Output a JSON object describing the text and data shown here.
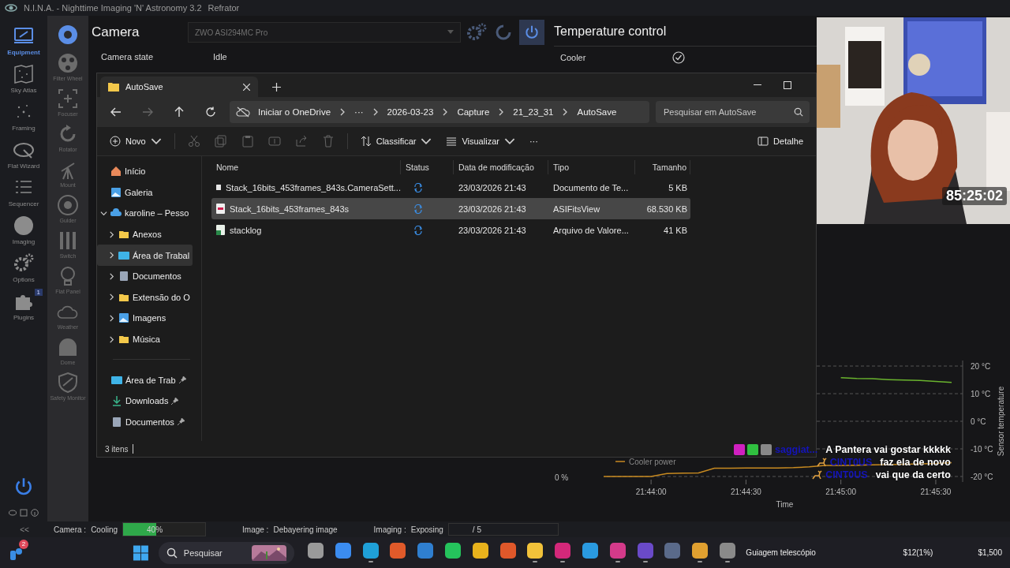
{
  "window": {
    "title": "N.I.N.A. - Nighttime Imaging 'N' Astronomy 3.2",
    "profile": "Refrator"
  },
  "main_nav": [
    {
      "label": "Equipment",
      "kind": "equipment",
      "selected": true
    },
    {
      "label": "Sky Atlas",
      "kind": "atlas",
      "selected": false
    },
    {
      "label": "Framing",
      "kind": "framing",
      "selected": false
    },
    {
      "label": "Flat Wizard",
      "kind": "flat",
      "selected": false
    },
    {
      "label": "Sequencer",
      "kind": "sequencer",
      "selected": false
    },
    {
      "label": "Imaging",
      "kind": "imaging",
      "selected": false
    },
    {
      "label": "Options",
      "kind": "options",
      "selected": false
    },
    {
      "label": "Plugins",
      "kind": "plugins",
      "selected": false,
      "badge": "1"
    }
  ],
  "equipment_nav": [
    {
      "kind": "camera",
      "selected": true
    },
    {
      "label": "Filter Wheel",
      "kind": "wheel",
      "selected": false
    },
    {
      "label": "Focuser",
      "kind": "focuser",
      "selected": false
    },
    {
      "label": "Rotator",
      "kind": "rotator",
      "selected": false
    },
    {
      "label": "Mount",
      "kind": "mount",
      "selected": false
    },
    {
      "label": "Guider",
      "kind": "guider",
      "selected": false
    },
    {
      "label": "Switch",
      "kind": "switch",
      "selected": false
    },
    {
      "label": "Flat Panel",
      "kind": "bulb",
      "selected": false
    },
    {
      "label": "Weather",
      "kind": "cloud",
      "selected": false
    },
    {
      "label": "Dome",
      "kind": "dome",
      "selected": false
    },
    {
      "label": "Safety Monitor",
      "kind": "shield",
      "selected": false
    }
  ],
  "camera": {
    "title": "Camera",
    "device": "ZWO ASI294MC Pro",
    "state_label": "Camera state",
    "state": "Idle"
  },
  "temperature": {
    "title": "Temperature control",
    "cooler_label": "Cooler",
    "cooler_on": true,
    "power_tick": "0 %",
    "chart_data": {
      "type": "line",
      "xlabel": "Time",
      "ylabel": "Sensor temperature",
      "categories": [
        null,
        null,
        null,
        "21:44:00",
        null,
        null,
        null,
        null,
        null,
        "21:44:30",
        null,
        null,
        null,
        null,
        null,
        "21:45:00",
        null,
        null,
        null,
        null,
        null,
        "21:45:30",
        null
      ],
      "grid": true,
      "ylim": [
        -22,
        22
      ],
      "yticks": [
        {
          "value": 20,
          "label": "20 °C"
        },
        {
          "value": 10,
          "label": "10 °C"
        },
        {
          "value": 0,
          "label": "0 °C"
        },
        {
          "value": -10,
          "label": "-10 °C"
        },
        {
          "value": -20,
          "label": "-20 °C"
        }
      ],
      "series": [
        {
          "color": "#6ab42e",
          "values": [
            null,
            null,
            null,
            null,
            null,
            null,
            null,
            null,
            null,
            null,
            null,
            null,
            null,
            null,
            null,
            15.8,
            15.5,
            15.4,
            15.1,
            14.9,
            14.8,
            14.4,
            14.1
          ]
        },
        {
          "name": "Cooler power",
          "color": "#c88a20",
          "values": [
            -20,
            -20,
            -20,
            -20,
            -18.9,
            -18.8,
            -18.7,
            -17,
            -17,
            -16.9,
            -16.9,
            -16.9,
            -16.8,
            -16.5,
            -16,
            -16,
            -15.9,
            -15.8,
            -15.7,
            -15.6,
            -15.4,
            -15.3,
            -15
          ]
        }
      ]
    }
  },
  "explorer": {
    "tab_title": "AutoSave",
    "crumbs": [
      "Iniciar o OneDrive",
      "···",
      "2026-03-23",
      "Capture",
      "21_23_31",
      "AutoSave"
    ],
    "search_placeholder": "Pesquisar em AutoSave",
    "toolbar": {
      "new": "Novo",
      "sort": "Classificar",
      "view": "Visualizar",
      "more": "···",
      "details": "Detalhe"
    },
    "nav": [
      {
        "label": "Início",
        "kind": "home",
        "selected": false
      },
      {
        "label": "Galeria",
        "kind": "gallery",
        "selected": false
      },
      {
        "label": "karoline – Pesso",
        "kind": "cloud",
        "selected": false,
        "expanded": true,
        "children": [
          {
            "label": "Anexos",
            "kind": "folder",
            "selected": false,
            "expanded": false
          },
          {
            "label": "Área de Trabal",
            "kind": "desktop",
            "selected": true,
            "expanded": false
          },
          {
            "label": "Documentos",
            "kind": "document",
            "selected": false,
            "expanded": false
          },
          {
            "label": "Extensão do O",
            "kind": "folder",
            "selected": false,
            "expanded": false
          },
          {
            "label": "Imagens",
            "kind": "pictures",
            "selected": false,
            "expanded": false
          },
          {
            "label": "Música",
            "kind": "folder",
            "selected": false,
            "expanded": false
          }
        ]
      }
    ],
    "pinned": [
      {
        "label": "Área de Trab",
        "kind": "desktop",
        "selected": false
      },
      {
        "label": "Downloads",
        "kind": "download",
        "selected": false
      },
      {
        "label": "Documentos",
        "kind": "document",
        "selected": false
      }
    ],
    "columns": [
      "Nome",
      "Status",
      "Data de modificação",
      "Tipo",
      "Tamanho"
    ],
    "files": [
      {
        "name": "Stack_16bits_453frames_843s.CameraSett...",
        "kind": "text",
        "date": "23/03/2026 21:43",
        "type": "Documento de Te...",
        "size": "5 KB",
        "selected": false
      },
      {
        "name": "Stack_16bits_453frames_843s",
        "kind": "fits",
        "date": "23/03/2026 21:43",
        "type": "ASIFitsView",
        "size": "68.530 KB",
        "selected": true
      },
      {
        "name": "stacklog",
        "kind": "csv",
        "date": "23/03/2026 21:43",
        "type": "Arquivo de Valore...",
        "size": "41 KB",
        "selected": false
      }
    ],
    "status": "3 itens"
  },
  "webcam": {
    "timer": "85:25:02"
  },
  "chat": [
    {
      "kind": "badges",
      "user": "saggiat...",
      "message": "A Pantera vai gostar kkkkk"
    },
    {
      "kind": "deer",
      "user": "CINT0US",
      "message": "faz ela de novo"
    },
    {
      "kind": "deer",
      "user": "CINT0US",
      "message": "vai que da certo"
    }
  ],
  "status_bar": {
    "collapse": "<<",
    "items": [
      {
        "label": "Camera :",
        "value": "Cooling",
        "kind": "progress",
        "level": 0.4,
        "reading": "40%"
      },
      {
        "label": "Image :",
        "value": "Debayering image",
        "kind": "text"
      },
      {
        "label": "Imaging :",
        "value": "Exposing",
        "kind": "count",
        "reading": "/ 5"
      }
    ]
  },
  "taskbar": {
    "badge": "2",
    "search": "Pesquisar",
    "apps": [
      {
        "color": "#9a9a9a",
        "running": false
      },
      {
        "color": "#3b8cf0",
        "running": false
      },
      {
        "color": "#1fa0d8",
        "running": true
      },
      {
        "color": "#e05a2a",
        "running": false
      },
      {
        "color": "#2f7fd0",
        "running": false
      },
      {
        "color": "#25c35c",
        "running": false
      },
      {
        "color": "#e8b21c",
        "running": false
      },
      {
        "color": "#e0582a",
        "running": false
      },
      {
        "color": "#f2c23a",
        "running": true
      },
      {
        "color": "#d4287a",
        "running": true
      },
      {
        "color": "#2a9ae0",
        "running": false
      },
      {
        "color": "#d43a8a",
        "running": true
      },
      {
        "color": "#6a4ac8",
        "running": true
      },
      {
        "color": "#5a6a8a",
        "running": false
      },
      {
        "color": "#e0a030",
        "running": true
      },
      {
        "color": "#8a8a8a",
        "running": true
      }
    ],
    "label": "Guiagem telescópio",
    "amount": "$12(1%)",
    "total": "$1,500"
  }
}
